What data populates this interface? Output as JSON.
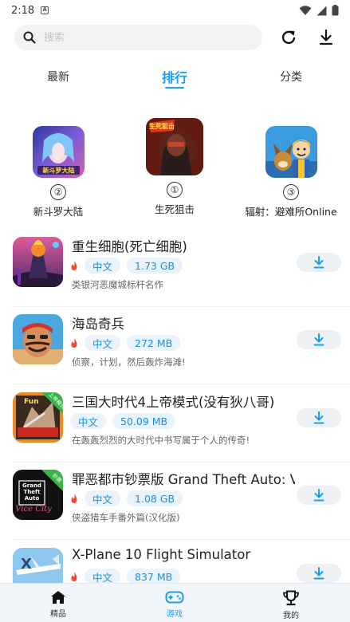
{
  "status_bar": {
    "time": "2:18",
    "app_icon_letter": "A"
  },
  "search": {
    "placeholder": "搜索"
  },
  "tabs": [
    {
      "label": "最新",
      "active": false
    },
    {
      "label": "排行",
      "active": true
    },
    {
      "label": "分类",
      "active": false
    }
  ],
  "top3": [
    {
      "rank": "②",
      "name": "新斗罗大陆",
      "icon_text": "新斗罗大陆"
    },
    {
      "rank": "①",
      "name": "生死狙击",
      "icon_text": "生死狙击"
    },
    {
      "rank": "③",
      "name": "辐射：避难所Online",
      "icon_text": ""
    }
  ],
  "apps": [
    {
      "name": "重生细胞(死亡细胞)",
      "tags": [
        "中文",
        "1.73 GB"
      ],
      "desc": "类银河恶魔城标杆名作"
    },
    {
      "name": "海岛奇兵",
      "tags": [
        "中文",
        "272 MB"
      ],
      "desc": "侦察，计划，然后轰炸海滩!"
    },
    {
      "name": "三国大时代4上帝模式(没有狄八哥)",
      "tags": [
        "中文",
        "50.09 MB"
      ],
      "desc": "在轰轰烈烈的大时代中书写属于个人的传奇!",
      "badge": "Fun",
      "corner": "上帝模式"
    },
    {
      "name": "罪恶都市钞票版 Grand Theft Auto: Vice City",
      "tags": [
        "中文",
        "1.08 GB"
      ],
      "desc": "侠盗猎车手番外篇(汉化版)",
      "corner": "钞票"
    },
    {
      "name": "X-Plane 10 Flight Simulator",
      "tags": [
        "中文",
        "837 MB"
      ],
      "desc": ""
    }
  ],
  "bottom_nav": [
    {
      "label": "精品",
      "active": false
    },
    {
      "label": "游戏",
      "active": true
    },
    {
      "label": "我的",
      "active": false
    }
  ],
  "colors": {
    "accent": "#1a9cf0",
    "tag_bg": "#eaf3fb",
    "hot": "#f04a2e"
  }
}
